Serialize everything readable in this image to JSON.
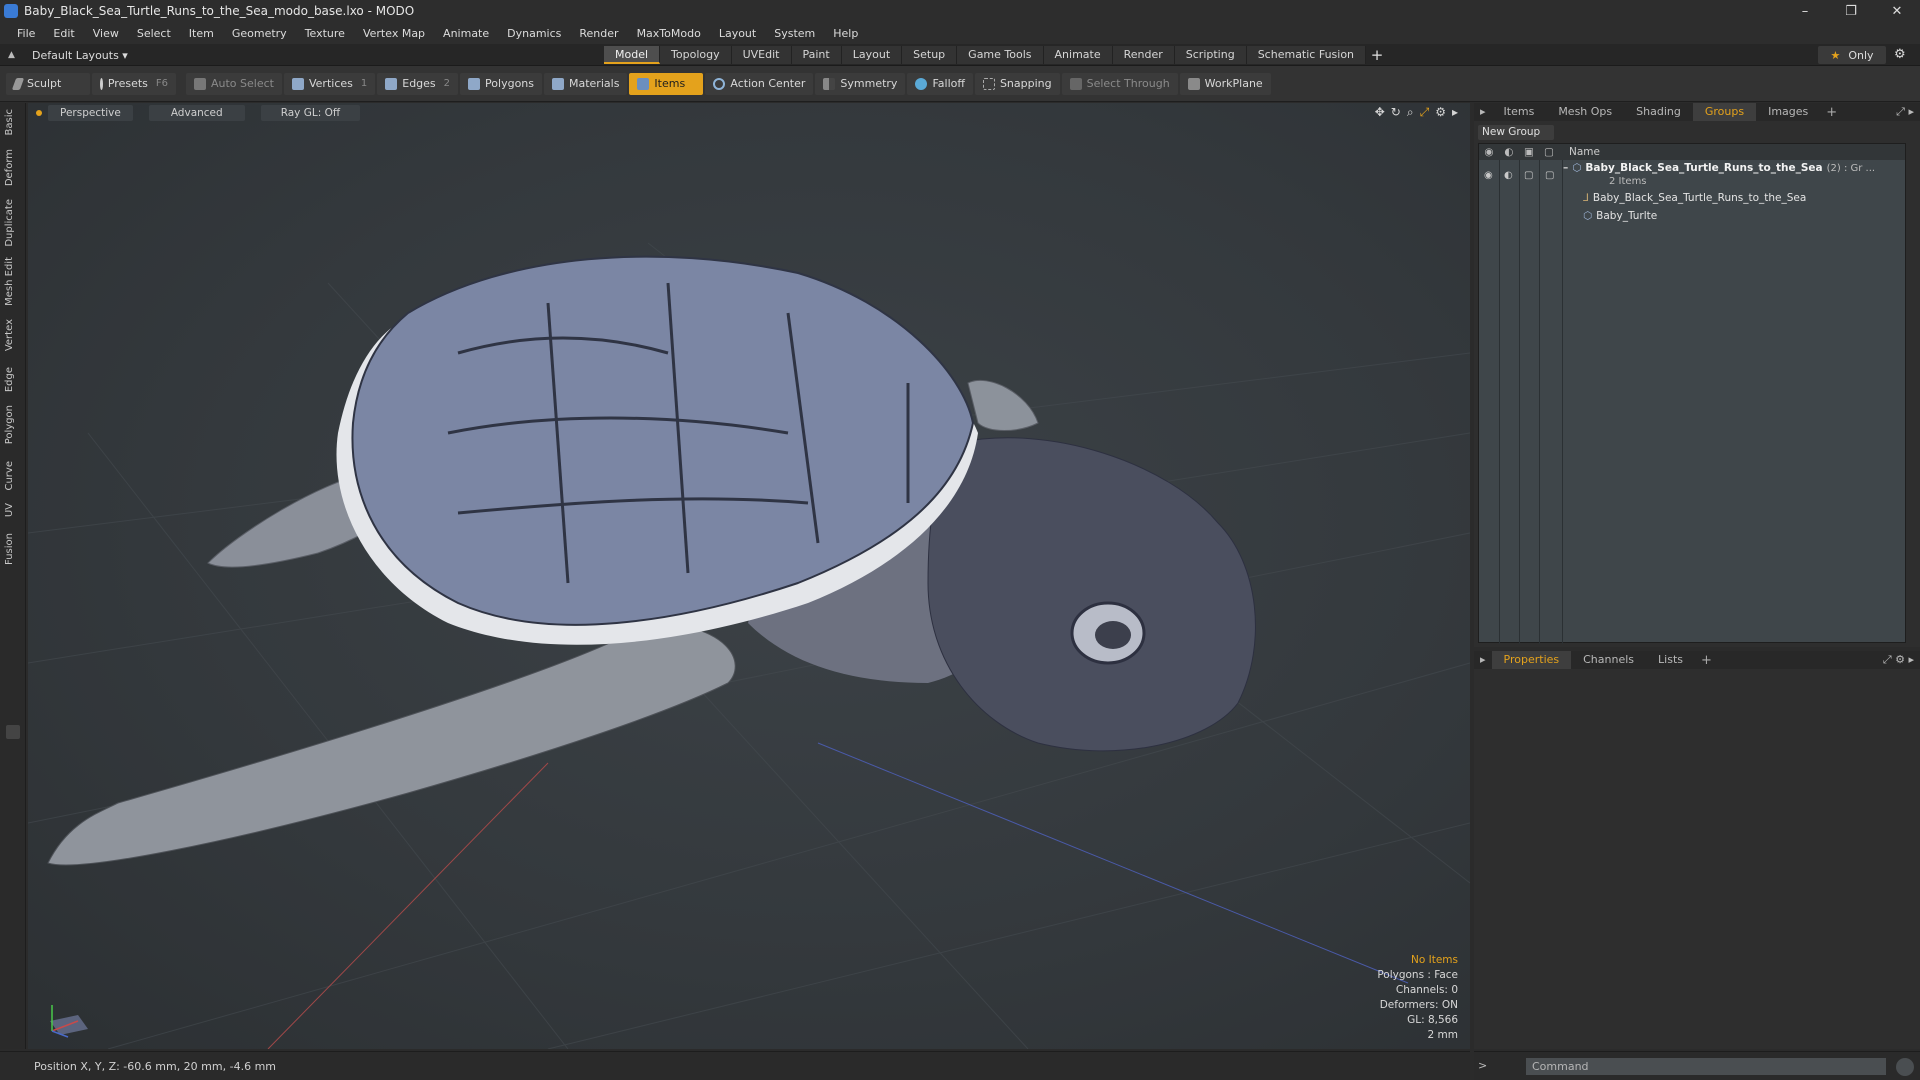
{
  "window": {
    "title": "Baby_Black_Sea_Turtle_Runs_to_the_Sea_modo_base.lxo - MODO",
    "controls": [
      "–",
      "❐",
      "✕"
    ]
  },
  "menu": [
    "File",
    "Edit",
    "View",
    "Select",
    "Item",
    "Geometry",
    "Texture",
    "Vertex Map",
    "Animate",
    "Dynamics",
    "Render",
    "MaxToModo",
    "Layout",
    "System",
    "Help"
  ],
  "layout_select": "Default Layouts ▾",
  "mode_tabs": [
    "Model",
    "Topology",
    "UVEdit",
    "Paint",
    "Layout",
    "Setup",
    "Game Tools",
    "Animate",
    "Render",
    "Scripting",
    "Schematic Fusion"
  ],
  "mode_plus": "+",
  "only_label": "Only",
  "tools": {
    "sculpt": "Sculpt",
    "presets": "Presets",
    "presets_key": "F6",
    "auto_select": "Auto Select",
    "vertices": "Vertices",
    "vertices_key": "1",
    "edges": "Edges",
    "edges_key": "2",
    "polygons": "Polygons",
    "materials": "Materials",
    "items": "Items",
    "action_center": "Action Center",
    "symmetry": "Symmetry",
    "falloff": "Falloff",
    "snapping": "Snapping",
    "select_through": "Select Through",
    "workplane": "WorkPlane"
  },
  "left_tabs": [
    "Basic",
    "Deform",
    "Duplicate",
    "Mesh Edit",
    "Vertex",
    "Edge",
    "Polygon",
    "Curve",
    "UV",
    "Fusion"
  ],
  "viewport": {
    "view_mode": "Perspective",
    "shading": "Advanced",
    "raygl": "Ray GL: Off",
    "info": {
      "selection": "No Items",
      "polygons": "Polygons : Face",
      "channels": "Channels: 0",
      "deformers": "Deformers: ON",
      "gl": "GL: 8,566",
      "scale": "2 mm"
    }
  },
  "right_panel": {
    "tabs": [
      "Items",
      "Mesh Ops",
      "Shading",
      "Groups",
      "Images"
    ],
    "new_group": "New Group",
    "name_col": "Name",
    "tree": {
      "group_name": "Baby_Black_Sea_Turtle_Runs_to_the_Sea",
      "group_suffix": "(2) : Gr ...",
      "group_count": "2 Items",
      "child1": "Baby_Black_Sea_Turtle_Runs_to_the_Sea",
      "child2": "Baby_Turlte"
    },
    "bottom_tabs": [
      "Properties",
      "Channels",
      "Lists"
    ]
  },
  "status": {
    "position": "Position X, Y, Z:  -60.6 mm, 20 mm, -4.6 mm"
  },
  "command": {
    "placeholder": "Command"
  },
  "colors": {
    "accent": "#e4a21c",
    "viewport_bg": "#3a3f43",
    "panel_bg": "#2e2e2e"
  }
}
